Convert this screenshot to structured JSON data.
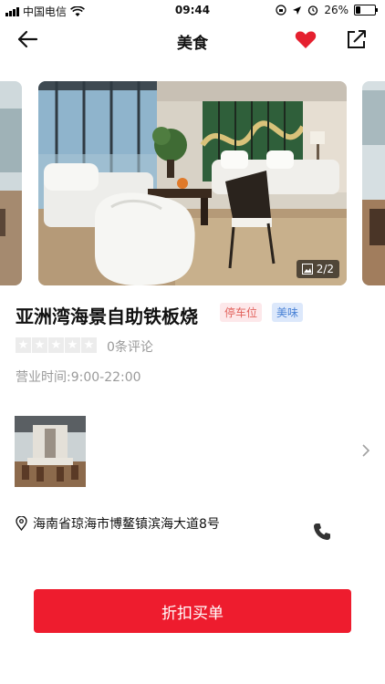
{
  "status_bar": {
    "carrier": "中国电信",
    "time": "09:44",
    "battery": "26%",
    "battery_level": 0.26
  },
  "nav": {
    "title": "美食"
  },
  "carousel": {
    "counter": "2/2"
  },
  "shop": {
    "name": "亚洲湾海景自助铁板烧",
    "tags": [
      "停车位",
      "美味"
    ],
    "reviews": "0条评论",
    "hours": "营业时间:9:00-22:00",
    "address": "海南省琼海市博鳌镇滨海大道8号"
  },
  "action": {
    "buy_label": "折扣买单"
  },
  "colors": {
    "accent": "#ee1c2e",
    "heart": "#e5202f"
  },
  "icons": [
    "back-arrow-icon",
    "heart-icon",
    "share-icon",
    "gallery-icon",
    "chevron-right-icon",
    "location-pin-icon",
    "phone-icon",
    "wifi-icon",
    "signal-icon",
    "battery-icon"
  ]
}
